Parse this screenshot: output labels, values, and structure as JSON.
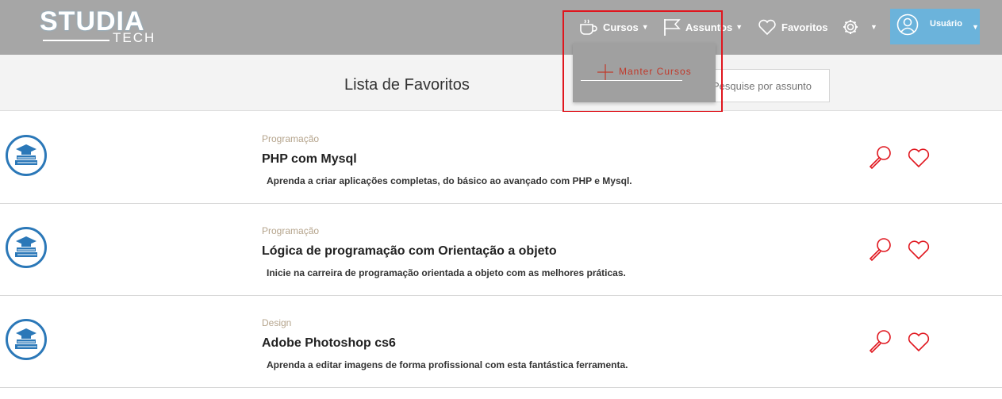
{
  "brand": {
    "name_top": "STUDIA",
    "name_bottom": "TECH"
  },
  "nav": {
    "cursos": "Cursos",
    "assuntos": "Assuntos",
    "favoritos": "Favoritos",
    "usuario": "Usuário"
  },
  "dropdown": {
    "item": "Manter Cursos"
  },
  "header": {
    "title": "Lista de Favoritos"
  },
  "search": {
    "placeholder": "Pesquise por assunto"
  },
  "courses": [
    {
      "category": "Programação",
      "title": "PHP com Mysql",
      "description": "Aprenda a criar aplicações completas, do básico ao avançado com PHP e Mysql."
    },
    {
      "category": "Programação",
      "title": "Lógica de programação com Orientação a objeto",
      "description": "Inicie na carreira de programação orientada a objeto com as melhores práticas."
    },
    {
      "category": "Design",
      "title": "Adobe Photoshop cs6",
      "description": "Aprenda a editar imagens de forma profissional com esta fantástica ferramenta."
    }
  ],
  "colors": {
    "navbar": "#a6a6a6",
    "user_button": "#6bb3db",
    "accent_red": "#e0161e",
    "icon_blue": "#2b78b8"
  },
  "icons": [
    "coffee-cup-icon",
    "flag-icon",
    "heart-icon",
    "gear-icon",
    "user-circle-icon",
    "graduation-book-icon",
    "magnifier-icon",
    "plus-icon"
  ]
}
